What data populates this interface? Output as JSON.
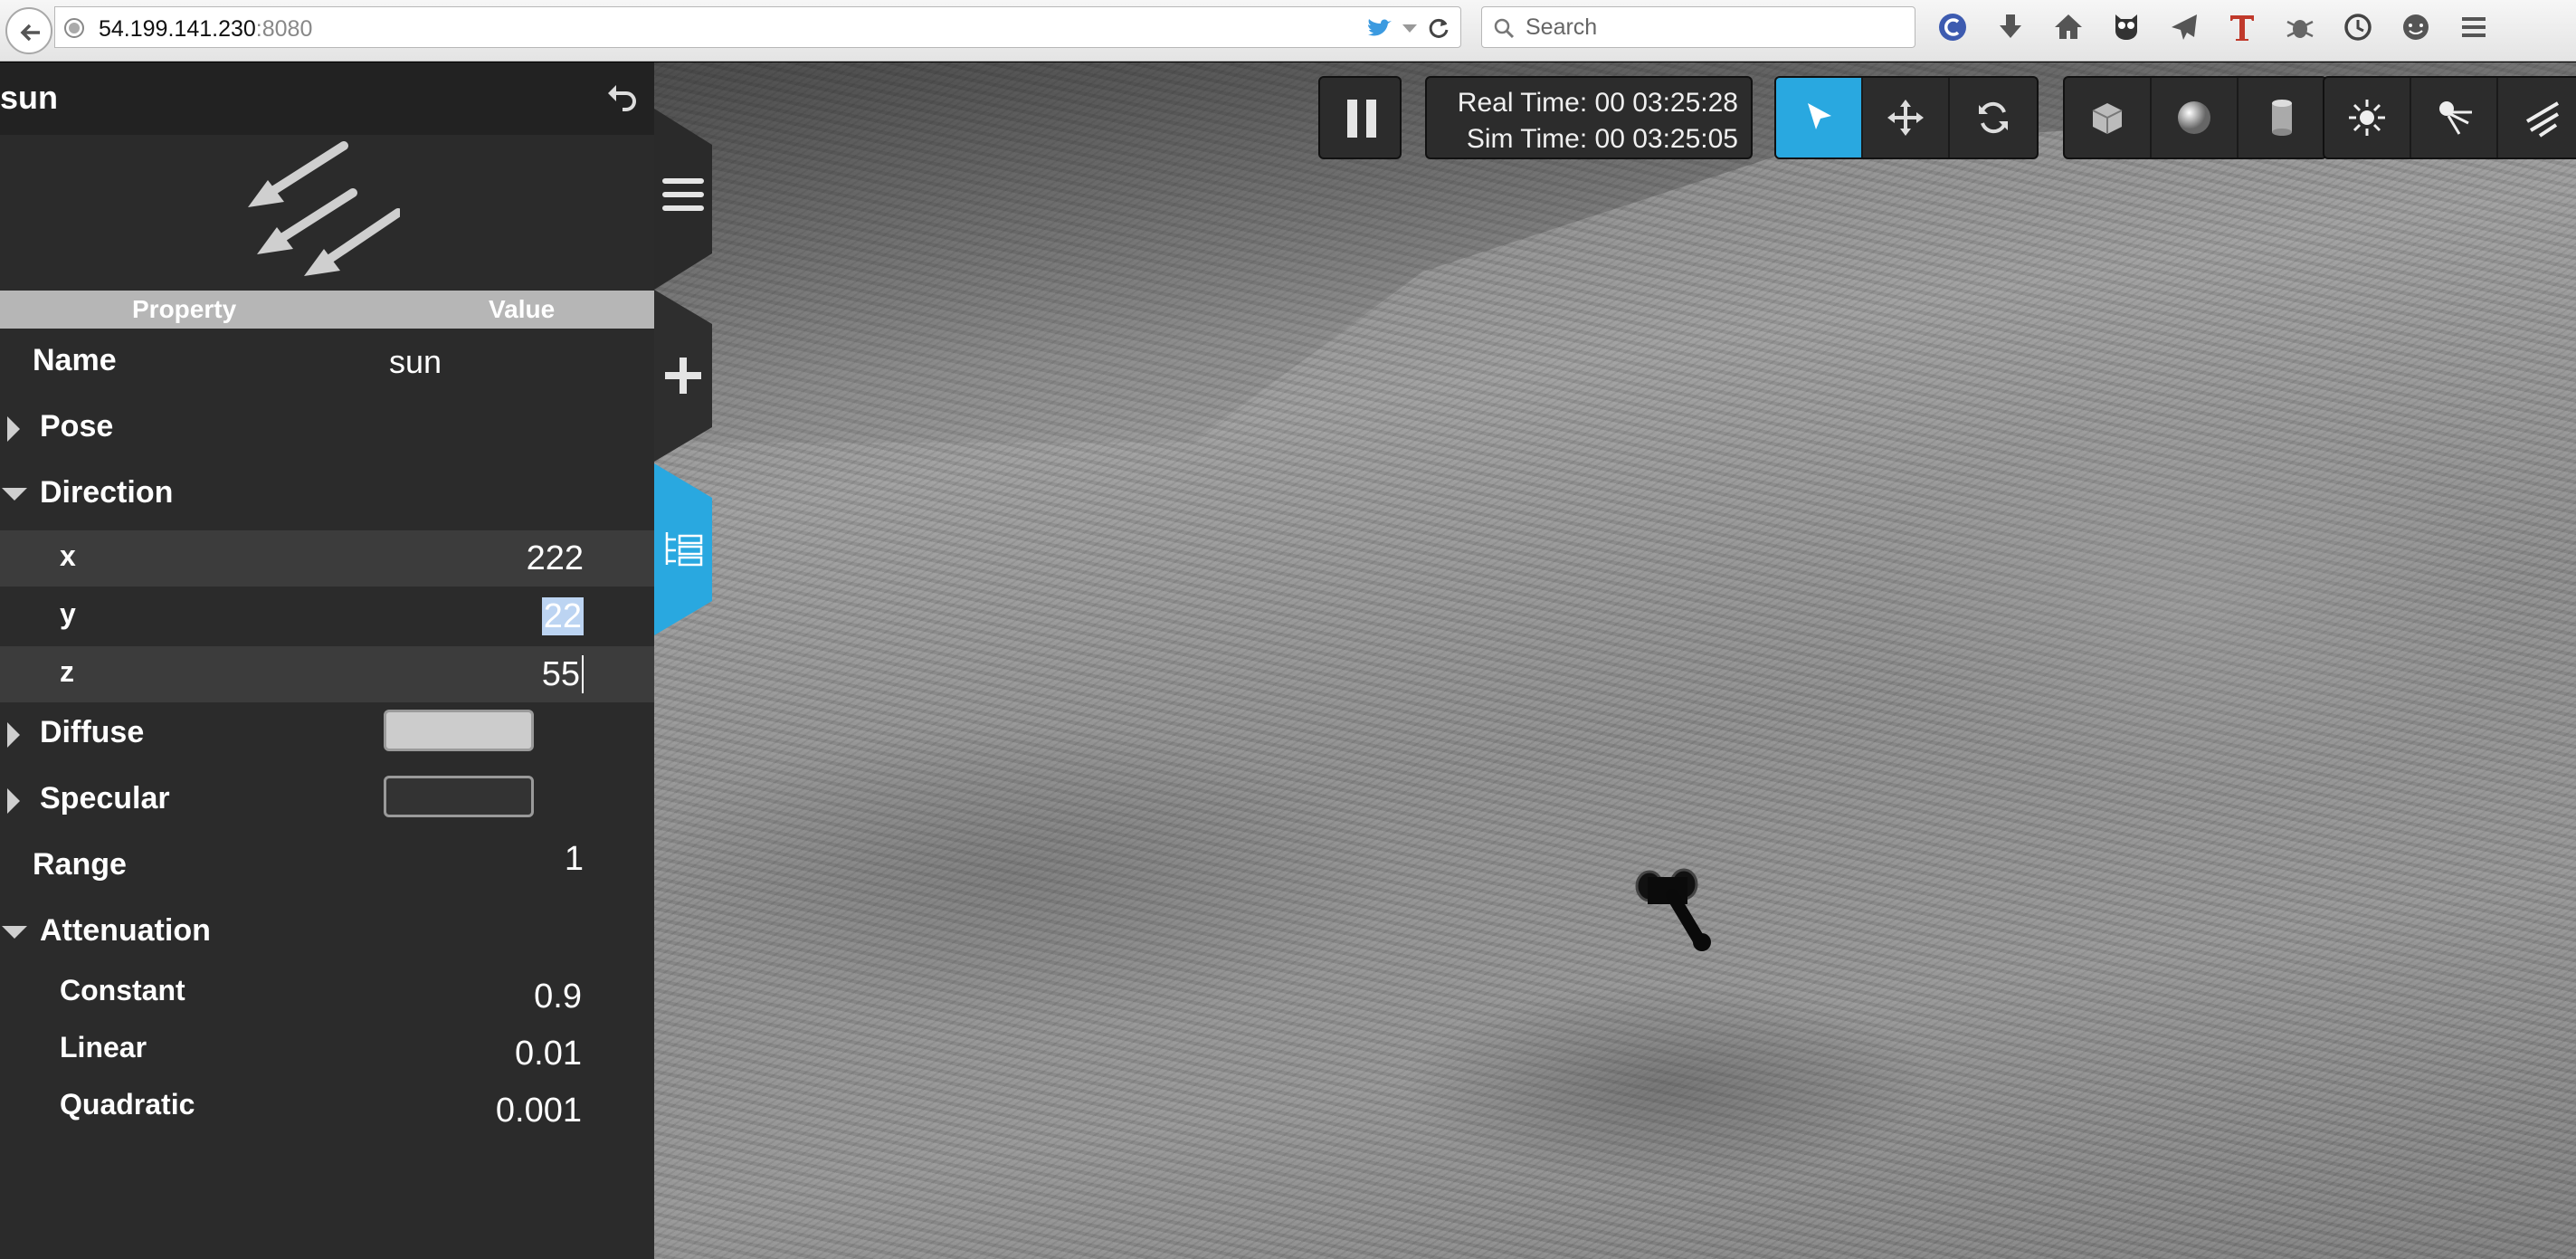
{
  "browser": {
    "url_host": "54.199.141.230",
    "url_port": ":8080",
    "search_placeholder": "Search"
  },
  "viewport": {
    "real_time_label": "Real Time: 00 03:25:28",
    "sim_time_label": "Sim Time: 00 03:25:05"
  },
  "toolbar": {
    "active_tool": "select",
    "tools": [
      "select",
      "translate",
      "rotate",
      "box",
      "sphere",
      "cylinder",
      "point-light",
      "spot-light",
      "directional-light"
    ],
    "accent_color": "#29a8e0"
  },
  "panel": {
    "title": "sun",
    "header_property": "Property",
    "header_value": "Value",
    "name_label": "Name",
    "name_value": "sun",
    "pose_label": "Pose",
    "direction_label": "Direction",
    "direction": {
      "x_label": "x",
      "x_value": "222",
      "y_label": "y",
      "y_value": "22",
      "z_label": "z",
      "z_value": "55"
    },
    "diffuse_label": "Diffuse",
    "diffuse_color": "#cccccc",
    "specular_label": "Specular",
    "specular_color": "#333333",
    "range_label": "Range",
    "range_value": "1",
    "attenuation_label": "Attenuation",
    "constant_label": "Constant",
    "constant_value": "0.9",
    "linear_label": "Linear",
    "linear_value": "0.01",
    "quadratic_label": "Quadratic",
    "quadratic_value": "0.001"
  }
}
